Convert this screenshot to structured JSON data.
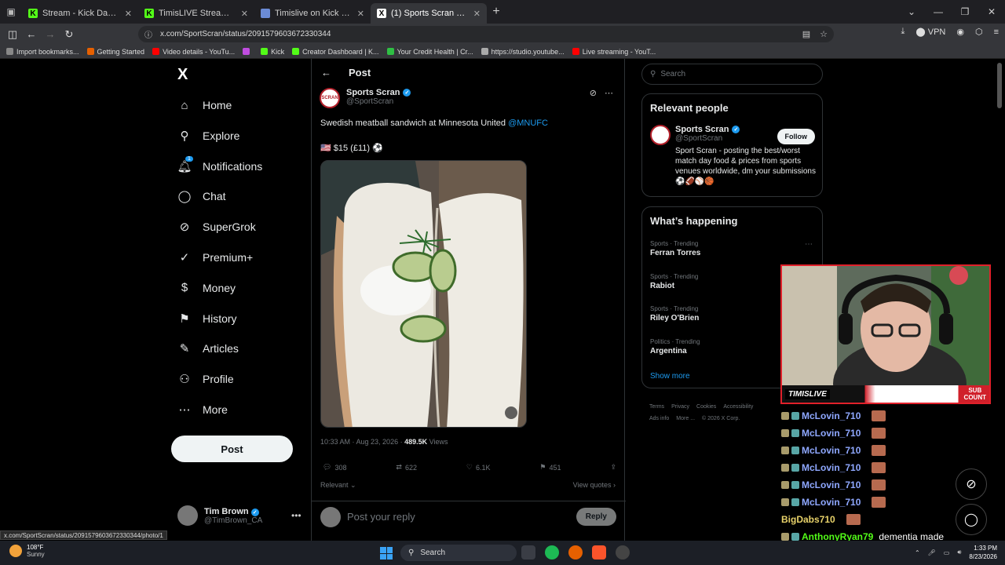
{
  "browser": {
    "tabs": [
      {
        "title": "Stream - Kick Dashboard",
        "fav_color": "#53fc18",
        "fav_text": "K",
        "active": false
      },
      {
        "title": "TimisLIVE Stream - Watch Live o",
        "fav_color": "#53fc18",
        "fav_text": "K",
        "active": false
      },
      {
        "title": "Timislive on Kick — Engagemen",
        "fav_color": "#6b8bd6",
        "fav_text": "",
        "active": false
      },
      {
        "title": "(1) Sports Scran on X: \"Swedish",
        "fav_color": "#ffffff",
        "fav_text": "X",
        "active": true
      }
    ],
    "url": "x.com/SportScran/status/2091579603672330344",
    "vpn_label": "VPN",
    "bookmarks": [
      {
        "label": "Import bookmarks...",
        "color": "#888888"
      },
      {
        "label": "Getting Started",
        "color": "#e66000"
      },
      {
        "label": "Video details - YouTu...",
        "color": "#ff0000"
      },
      {
        "label": "",
        "color": "#c04de0"
      },
      {
        "label": "Kick",
        "color": "#53fc18"
      },
      {
        "label": "Creator Dashboard | K...",
        "color": "#53fc18"
      },
      {
        "label": "Your Credit Health | Cr...",
        "color": "#2fbf44"
      },
      {
        "label": "https://studio.youtube...",
        "color": "#aaaaaa"
      },
      {
        "label": "Live streaming - YouT...",
        "color": "#ff0000"
      }
    ]
  },
  "nav": {
    "logo": "X",
    "items": [
      {
        "label": "Home",
        "icon": "home-icon",
        "glyph": "⌂"
      },
      {
        "label": "Explore",
        "icon": "search-icon",
        "glyph": "⚲"
      },
      {
        "label": "Notifications",
        "icon": "bell-icon",
        "glyph": "🔔︎"
      },
      {
        "label": "Chat",
        "icon": "chat-icon",
        "glyph": "◯"
      },
      {
        "label": "SuperGrok",
        "icon": "grok-icon",
        "glyph": "⊘"
      },
      {
        "label": "Premium+",
        "icon": "premium-icon",
        "glyph": "✓"
      },
      {
        "label": "Money",
        "icon": "money-icon",
        "glyph": "$"
      },
      {
        "label": "History",
        "icon": "bookmark-icon",
        "glyph": "⚑"
      },
      {
        "label": "Articles",
        "icon": "articles-icon",
        "glyph": "✎"
      },
      {
        "label": "Profile",
        "icon": "profile-icon",
        "glyph": "⚇"
      },
      {
        "label": "More",
        "icon": "more-icon",
        "glyph": "⋯"
      }
    ],
    "notification_badge": "1",
    "post_button": "Post",
    "account": {
      "name": "Tim Brown",
      "handle": "@TimBrown_CA"
    }
  },
  "post": {
    "header": "Post",
    "author_name": "Sports Scran",
    "author_handle": "@SportScran",
    "avatar_text": "SCRAN",
    "text": "Swedish meatball sandwich at Minnesota United ",
    "mention": "@MNUFC",
    "price_line": "🇺🇸 $15 (£11) ⚽",
    "timestamp": "10:33 AM · Aug 23, 2026 · ",
    "views_count": "489.5K",
    "views_label": " Views",
    "replies": "308",
    "reposts": "622",
    "likes": "6.1K",
    "bookmarks": "451",
    "sort_label": "Relevant",
    "view_quotes": "View quotes",
    "reply_placeholder": "Post your reply",
    "reply_button": "Reply"
  },
  "sidebar": {
    "search_placeholder": "Search",
    "relevant_title": "Relevant people",
    "rp_name": "Sports Scran",
    "rp_handle": "@SportScran",
    "rp_bio": "Sport Scran - posting the best/worst match day food & prices from sports venues worldwide, dm your submissions ⚽🏈⚾🏀",
    "follow_label": "Follow",
    "happening_title": "What’s happening",
    "trends": [
      {
        "category": "Sports · Trending",
        "name": "Ferran Torres"
      },
      {
        "category": "Sports · Trending",
        "name": "Rabiot"
      },
      {
        "category": "Sports · Trending",
        "name": "Riley O'Brien"
      },
      {
        "category": "Politics · Trending",
        "name": "Argentina"
      }
    ],
    "show_more": "Show more",
    "footer": [
      "Terms",
      "Privacy",
      "Cookies",
      "Accessibility",
      "Ads info",
      "More ...",
      "© 2026 X Corp."
    ]
  },
  "overlay": {
    "brand": "TIMISLIVE",
    "sub_count": "SUB\nCOUNT",
    "chat": [
      {
        "user": "McLovin_710",
        "color": "#8fa8ff",
        "msg": ""
      },
      {
        "user": "McLovin_710",
        "color": "#8fa8ff",
        "msg": ""
      },
      {
        "user": "McLovin_710",
        "color": "#8fa8ff",
        "msg": ""
      },
      {
        "user": "McLovin_710",
        "color": "#8fa8ff",
        "msg": ""
      },
      {
        "user": "McLovin_710",
        "color": "#8fa8ff",
        "msg": ""
      },
      {
        "user": "McLovin_710",
        "color": "#8fa8ff",
        "msg": ""
      },
      {
        "user": "BigDabs710",
        "color": "#e8d26a",
        "msg": ""
      },
      {
        "user": "AnthonyRyan79",
        "color": "#53fc18",
        "msg": "dementia made"
      }
    ]
  },
  "statusbar": {
    "link": "x.com/SportScran/status/2091579603672330344/photo/1"
  },
  "taskbar": {
    "temp": "108°F",
    "condition": "Sunny",
    "search": "Search",
    "time": "1:33 PM",
    "date": "8/23/2026"
  }
}
